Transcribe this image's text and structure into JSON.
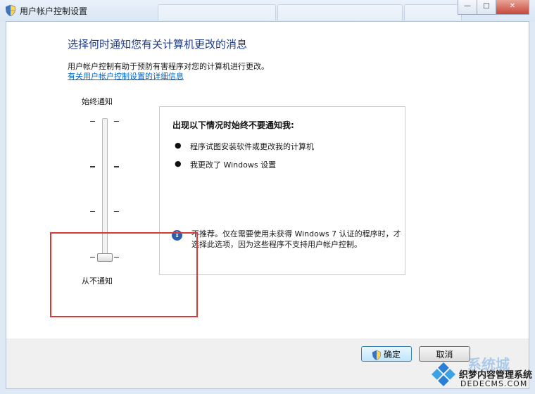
{
  "window": {
    "title": "用户帐户控制设置",
    "controls": {
      "minimize": "—",
      "maximize": "□",
      "close": "✕"
    }
  },
  "main": {
    "heading": "选择何时通知您有关计算机更改的消息",
    "description": "用户帐户控制有助于预防有害程序对您的计算机进行更改。",
    "link": "有关用户帐户控制设置的详细信息"
  },
  "slider": {
    "top_label": "始终通知",
    "bottom_label": "从不通知",
    "levels": 4,
    "current_level": 1
  },
  "info_panel": {
    "heading": "出现以下情况时始终不要通知我:",
    "bullets": [
      "程序试图安装软件或更改我的计算机",
      "我更改了 Windows 设置"
    ],
    "note": "不推荐。仅在需要使用未获得 Windows 7 认证的程序时，才选择此选项，因为这些程序不支持用户帐户控制。"
  },
  "buttons": {
    "ok": "确定",
    "cancel": "取消"
  },
  "watermark": {
    "line1": "织梦内容管理系统",
    "line2": "DEDECMS.COM",
    "top": "系统城"
  },
  "colors": {
    "heading": "#1e3c8c",
    "link": "#0066cc",
    "highlight": "#d73a3a"
  },
  "icons": [
    "shield-icon",
    "info-icon",
    "windows-logo-icon"
  ]
}
